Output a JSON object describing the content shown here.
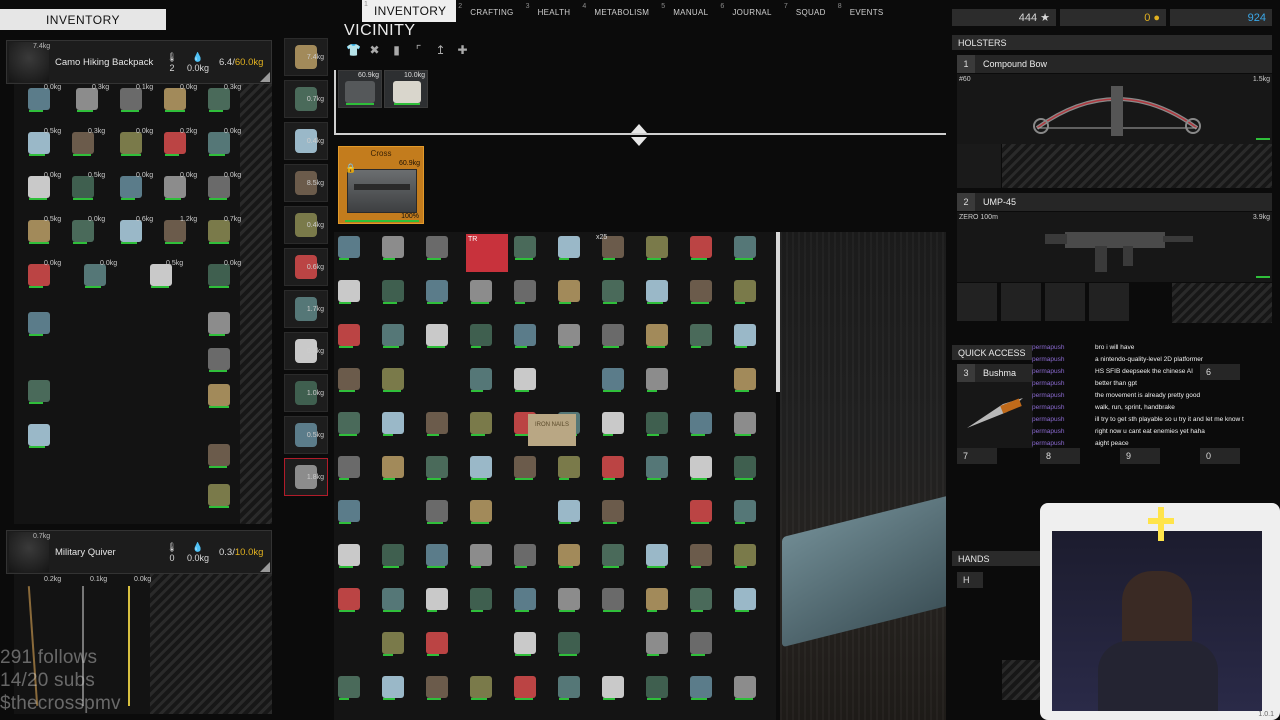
{
  "nav": {
    "tabs": [
      {
        "num": "1",
        "label": "INVENTORY"
      },
      {
        "num": "2",
        "label": "CRAFTING"
      },
      {
        "num": "3",
        "label": "HEALTH"
      },
      {
        "num": "4",
        "label": "METABOLISM"
      },
      {
        "num": "5",
        "label": "MANUAL"
      },
      {
        "num": "6",
        "label": "JOURNAL"
      },
      {
        "num": "7",
        "label": "SQUAD"
      },
      {
        "num": "8",
        "label": "EVENTS"
      }
    ]
  },
  "inventory": {
    "title": "INVENTORY",
    "backpack": {
      "weight": "7.4kg",
      "name": "Camo Hiking Backpack",
      "temp": "2",
      "water": "0.0kg",
      "cap_used": "6.4/",
      "cap_max": "60.0kg"
    },
    "quiver": {
      "weight": "0.7kg",
      "name": "Military Quiver",
      "temp": "0",
      "water": "0.0kg",
      "cap_used": "0.3/",
      "cap_max": "10.0kg",
      "item_weights": [
        "0.2kg",
        "0.1kg",
        "0.0kg"
      ]
    },
    "weights": [
      "0.0kg",
      "0.3kg",
      "0.1kg",
      "0.0kg",
      "0.3kg",
      "0.5kg",
      "0.3kg",
      "0.0kg",
      "0.2kg",
      "0.0kg",
      "0.0kg",
      "0.5kg",
      "0.0kg",
      "0.0kg",
      "0.0kg",
      "0.5kg",
      "0.0kg",
      "0.6kg",
      "1.2kg",
      "0.7kg",
      "0.0kg",
      "0.0kg",
      "0.5kg",
      "0.0kg"
    ]
  },
  "equipment": {
    "weights": [
      "7.4kg",
      "0.7kg",
      "0.4kg",
      "8.5kg",
      "0.4kg",
      "0.6kg",
      "1.7kg",
      "0.4kg",
      "1.0kg",
      "0.5kg",
      "1.8kg"
    ]
  },
  "vicinity": {
    "title": "VICINITY",
    "ground": [
      {
        "weight": "60.9kg"
      },
      {
        "weight": "10.0kg"
      }
    ],
    "crate": {
      "name": "Cross",
      "weight": "60.9kg",
      "percent": "100%"
    },
    "labels": {
      "tr": "TR",
      "stack": "x25",
      "note": "IRON NAILS"
    }
  },
  "stats": {
    "score": "444",
    "gold": "0",
    "currency": "924"
  },
  "holsters": {
    "title": "HOLSTERS",
    "slot1": {
      "num": "1",
      "name": "Compound Bow",
      "ammo": "#60",
      "weight": "1.5kg"
    },
    "slot2": {
      "num": "2",
      "name": "UMP-45",
      "ammo": "ZERO 100m",
      "weight": "3.9kg"
    }
  },
  "quick_access": {
    "title": "QUICK ACCESS",
    "slot3": {
      "num": "3",
      "name": "Bushma"
    },
    "nums": [
      "6",
      "7",
      "8",
      "9",
      "0"
    ]
  },
  "hands": {
    "title": "HANDS",
    "slot": "H"
  },
  "chat": {
    "messages": [
      "bro i will have",
      "a nintendo-quality-level 2D platformer",
      "HS SFIB deepseek the chinese AI",
      "better than gpt",
      "the movement is already pretty good",
      "walk, run, sprint, handbrake",
      "ill try to get sth playable so u try it and let me know t",
      "right now u cant eat enemies yet haha",
      "aight peace"
    ],
    "user": "permapush"
  },
  "stream": {
    "follows": "291 follows",
    "subs": "14/20 subs",
    "name": "$thecrosspmv"
  },
  "version": "1.0.1",
  "colors": {
    "accent_orange": "#c37c1d",
    "health_green": "#2fbf3a",
    "gold": "#e0b020",
    "currency_blue": "#3aa7e8",
    "chat_user": "#8b6ad1"
  }
}
